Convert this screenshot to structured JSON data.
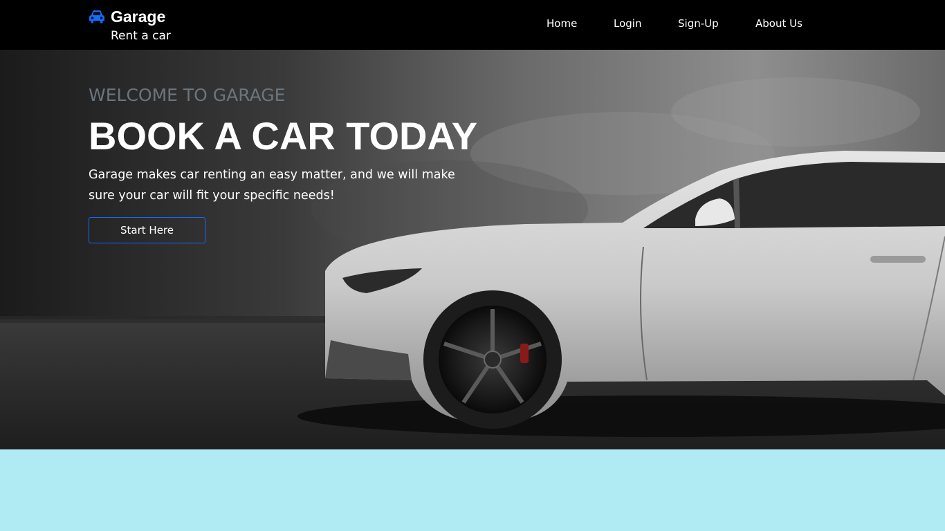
{
  "navbar": {
    "brand_name": "Garage",
    "brand_tagline": "Rent a car",
    "brand_icon": "car-icon",
    "brand_icon_color": "#0d6efd",
    "links": [
      {
        "label": "Home"
      },
      {
        "label": "Login"
      },
      {
        "label": "Sign-Up"
      },
      {
        "label": "About Us"
      }
    ]
  },
  "hero": {
    "welcome": "WELCOME TO GARAGE",
    "headline": "BOOK A CAR TODAY",
    "lead": "Garage makes car renting an easy matter, and we will make sure your car will fit your specific needs!",
    "button_label": "Start Here",
    "button_border_color": "#0d6efd",
    "image": "white-sports-car-photo"
  },
  "colors": {
    "navbar_bg": "#000000",
    "lower_section_bg": "#b0ebf4",
    "welcome_text": "#6c757d"
  }
}
